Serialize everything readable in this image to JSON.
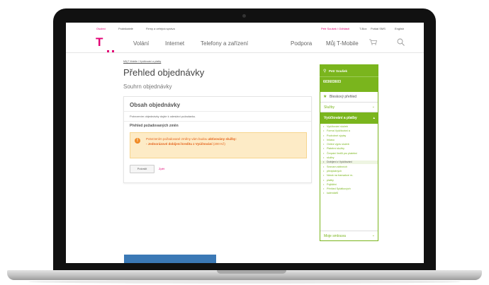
{
  "topbar": {
    "private": "Osobní",
    "business": "Podnikatelé",
    "corporate": "Firmy a veřejná správa",
    "user": "Petr Soušek / Odhlásit",
    "tbox": "T-Box",
    "postal": "Poštal SMS",
    "english": "English"
  },
  "header": {
    "logo": "T",
    "nav": [
      "Volání",
      "Internet",
      "Telefony a zařízení",
      "Podpora",
      "Můj T-Mobile"
    ],
    "icons": [
      "cart-icon",
      "search-icon"
    ]
  },
  "breadcrumb": "Můj T-Mobile / Vyúčtování a platby",
  "page": {
    "title": "Přehled objednávky",
    "subtitle": "Souhrn objednávky"
  },
  "order": {
    "title": "Obsah objednávky",
    "description": "Potvrzením objednávky dojde k odeslání požadavku.",
    "section": "Přehled požadovaných změn",
    "alert_prefix": "Potvrzením požadované změny vám budou",
    "alert_bold": "aktivovány služby:",
    "alert_item": "- Jednorázové dobíjení kreditu z Vyúčtování",
    "alert_price": "(200 Kč)",
    "confirm_label": "Potvrdit",
    "back_label": "Zpět"
  },
  "sidebar": {
    "user_name": "Petr Soušek",
    "phone": "603603603",
    "quick_overview": "Bleskový přehled",
    "services": "Služby",
    "billing": "Vyúčtování a platby",
    "items": [
      "Vyúčtování služeb",
      "Forma Vyúčtování a",
      "Podrobné výpisy",
      "Inkaso",
      "Online výpis služeb",
      "Platební služby",
      "Čerpání limitů pro platební",
      "služby",
      "Dobíjení z Vyúčtování",
      "Seznam aktivních",
      "předplatných",
      "Nárok na transakce m-",
      "platby",
      "Pojištění",
      "Přehled Splátkových",
      "kalendářů"
    ],
    "active_item": "Dobíjení z Vyúčtování",
    "contract": "Moje smlouva"
  },
  "colors": {
    "magenta": "#e20074",
    "green": "#7ab51d",
    "alert_bg": "#fdebc6",
    "alert_text": "#e4611a"
  }
}
